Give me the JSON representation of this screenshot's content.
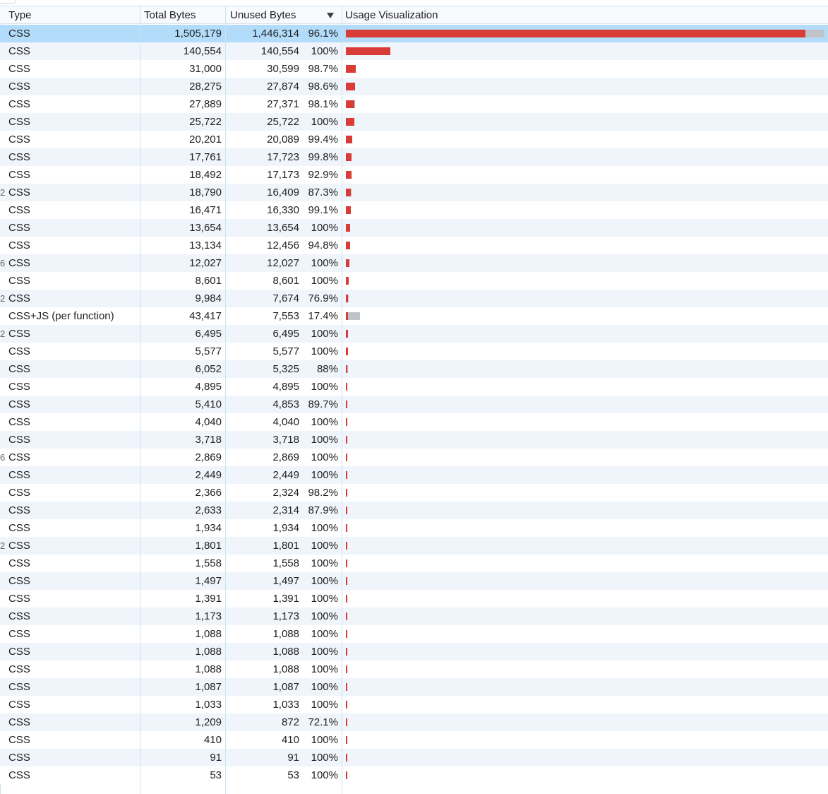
{
  "header": {
    "type": "Type",
    "total_bytes": "Total Bytes",
    "unused_bytes": "Unused Bytes",
    "usage_visualization": "Usage Visualization"
  },
  "sort": {
    "column": "unused_bytes",
    "direction": "descending",
    "icon": "sort-descending-icon"
  },
  "colors": {
    "unused": "#d93b37",
    "used": "#c0c3c7",
    "selected_row": "#b3dcfb"
  },
  "rows": [
    {
      "trunc": "",
      "type": "CSS",
      "total": "1,505,179",
      "unused": "1,446,314",
      "pct": "96.1%",
      "selected": true
    },
    {
      "trunc": "",
      "type": "CSS",
      "total": "140,554",
      "unused": "140,554",
      "pct": "100%"
    },
    {
      "trunc": "",
      "type": "CSS",
      "total": "31,000",
      "unused": "30,599",
      "pct": "98.7%"
    },
    {
      "trunc": "",
      "type": "CSS",
      "total": "28,275",
      "unused": "27,874",
      "pct": "98.6%"
    },
    {
      "trunc": "",
      "type": "CSS",
      "total": "27,889",
      "unused": "27,371",
      "pct": "98.1%"
    },
    {
      "trunc": "",
      "type": "CSS",
      "total": "25,722",
      "unused": "25,722",
      "pct": "100%"
    },
    {
      "trunc": "",
      "type": "CSS",
      "total": "20,201",
      "unused": "20,089",
      "pct": "99.4%"
    },
    {
      "trunc": "",
      "type": "CSS",
      "total": "17,761",
      "unused": "17,723",
      "pct": "99.8%"
    },
    {
      "trunc": "",
      "type": "CSS",
      "total": "18,492",
      "unused": "17,173",
      "pct": "92.9%"
    },
    {
      "trunc": "2",
      "type": "CSS",
      "total": "18,790",
      "unused": "16,409",
      "pct": "87.3%"
    },
    {
      "trunc": "",
      "type": "CSS",
      "total": "16,471",
      "unused": "16,330",
      "pct": "99.1%"
    },
    {
      "trunc": "",
      "type": "CSS",
      "total": "13,654",
      "unused": "13,654",
      "pct": "100%"
    },
    {
      "trunc": "",
      "type": "CSS",
      "total": "13,134",
      "unused": "12,456",
      "pct": "94.8%"
    },
    {
      "trunc": "6",
      "type": "CSS",
      "total": "12,027",
      "unused": "12,027",
      "pct": "100%"
    },
    {
      "trunc": "",
      "type": "CSS",
      "total": "8,601",
      "unused": "8,601",
      "pct": "100%"
    },
    {
      "trunc": "2",
      "type": "CSS",
      "total": "9,984",
      "unused": "7,674",
      "pct": "76.9%"
    },
    {
      "trunc": "",
      "type": "CSS+JS (per function)",
      "total": "43,417",
      "unused": "7,553",
      "pct": "17.4%"
    },
    {
      "trunc": "2",
      "type": "CSS",
      "total": "6,495",
      "unused": "6,495",
      "pct": "100%"
    },
    {
      "trunc": "",
      "type": "CSS",
      "total": "5,577",
      "unused": "5,577",
      "pct": "100%"
    },
    {
      "trunc": "",
      "type": "CSS",
      "total": "6,052",
      "unused": "5,325",
      "pct": "88%"
    },
    {
      "trunc": "",
      "type": "CSS",
      "total": "4,895",
      "unused": "4,895",
      "pct": "100%"
    },
    {
      "trunc": "",
      "type": "CSS",
      "total": "5,410",
      "unused": "4,853",
      "pct": "89.7%"
    },
    {
      "trunc": "",
      "type": "CSS",
      "total": "4,040",
      "unused": "4,040",
      "pct": "100%"
    },
    {
      "trunc": "",
      "type": "CSS",
      "total": "3,718",
      "unused": "3,718",
      "pct": "100%"
    },
    {
      "trunc": "6",
      "type": "CSS",
      "total": "2,869",
      "unused": "2,869",
      "pct": "100%"
    },
    {
      "trunc": "",
      "type": "CSS",
      "total": "2,449",
      "unused": "2,449",
      "pct": "100%"
    },
    {
      "trunc": "",
      "type": "CSS",
      "total": "2,366",
      "unused": "2,324",
      "pct": "98.2%"
    },
    {
      "trunc": "",
      "type": "CSS",
      "total": "2,633",
      "unused": "2,314",
      "pct": "87.9%"
    },
    {
      "trunc": "",
      "type": "CSS",
      "total": "1,934",
      "unused": "1,934",
      "pct": "100%"
    },
    {
      "trunc": "2",
      "type": "CSS",
      "total": "1,801",
      "unused": "1,801",
      "pct": "100%"
    },
    {
      "trunc": "",
      "type": "CSS",
      "total": "1,558",
      "unused": "1,558",
      "pct": "100%"
    },
    {
      "trunc": "",
      "type": "CSS",
      "total": "1,497",
      "unused": "1,497",
      "pct": "100%"
    },
    {
      "trunc": "",
      "type": "CSS",
      "total": "1,391",
      "unused": "1,391",
      "pct": "100%"
    },
    {
      "trunc": "",
      "type": "CSS",
      "total": "1,173",
      "unused": "1,173",
      "pct": "100%"
    },
    {
      "trunc": "",
      "type": "CSS",
      "total": "1,088",
      "unused": "1,088",
      "pct": "100%"
    },
    {
      "trunc": "",
      "type": "CSS",
      "total": "1,088",
      "unused": "1,088",
      "pct": "100%"
    },
    {
      "trunc": "",
      "type": "CSS",
      "total": "1,088",
      "unused": "1,088",
      "pct": "100%"
    },
    {
      "trunc": "",
      "type": "CSS",
      "total": "1,087",
      "unused": "1,087",
      "pct": "100%"
    },
    {
      "trunc": "",
      "type": "CSS",
      "total": "1,033",
      "unused": "1,033",
      "pct": "100%"
    },
    {
      "trunc": "",
      "type": "CSS",
      "total": "1,209",
      "unused": "872",
      "pct": "72.1%"
    },
    {
      "trunc": "",
      "type": "CSS",
      "total": "410",
      "unused": "410",
      "pct": "100%"
    },
    {
      "trunc": "",
      "type": "CSS",
      "total": "91",
      "unused": "91",
      "pct": "100%"
    },
    {
      "trunc": "",
      "type": "CSS",
      "total": "53",
      "unused": "53",
      "pct": "100%"
    }
  ]
}
